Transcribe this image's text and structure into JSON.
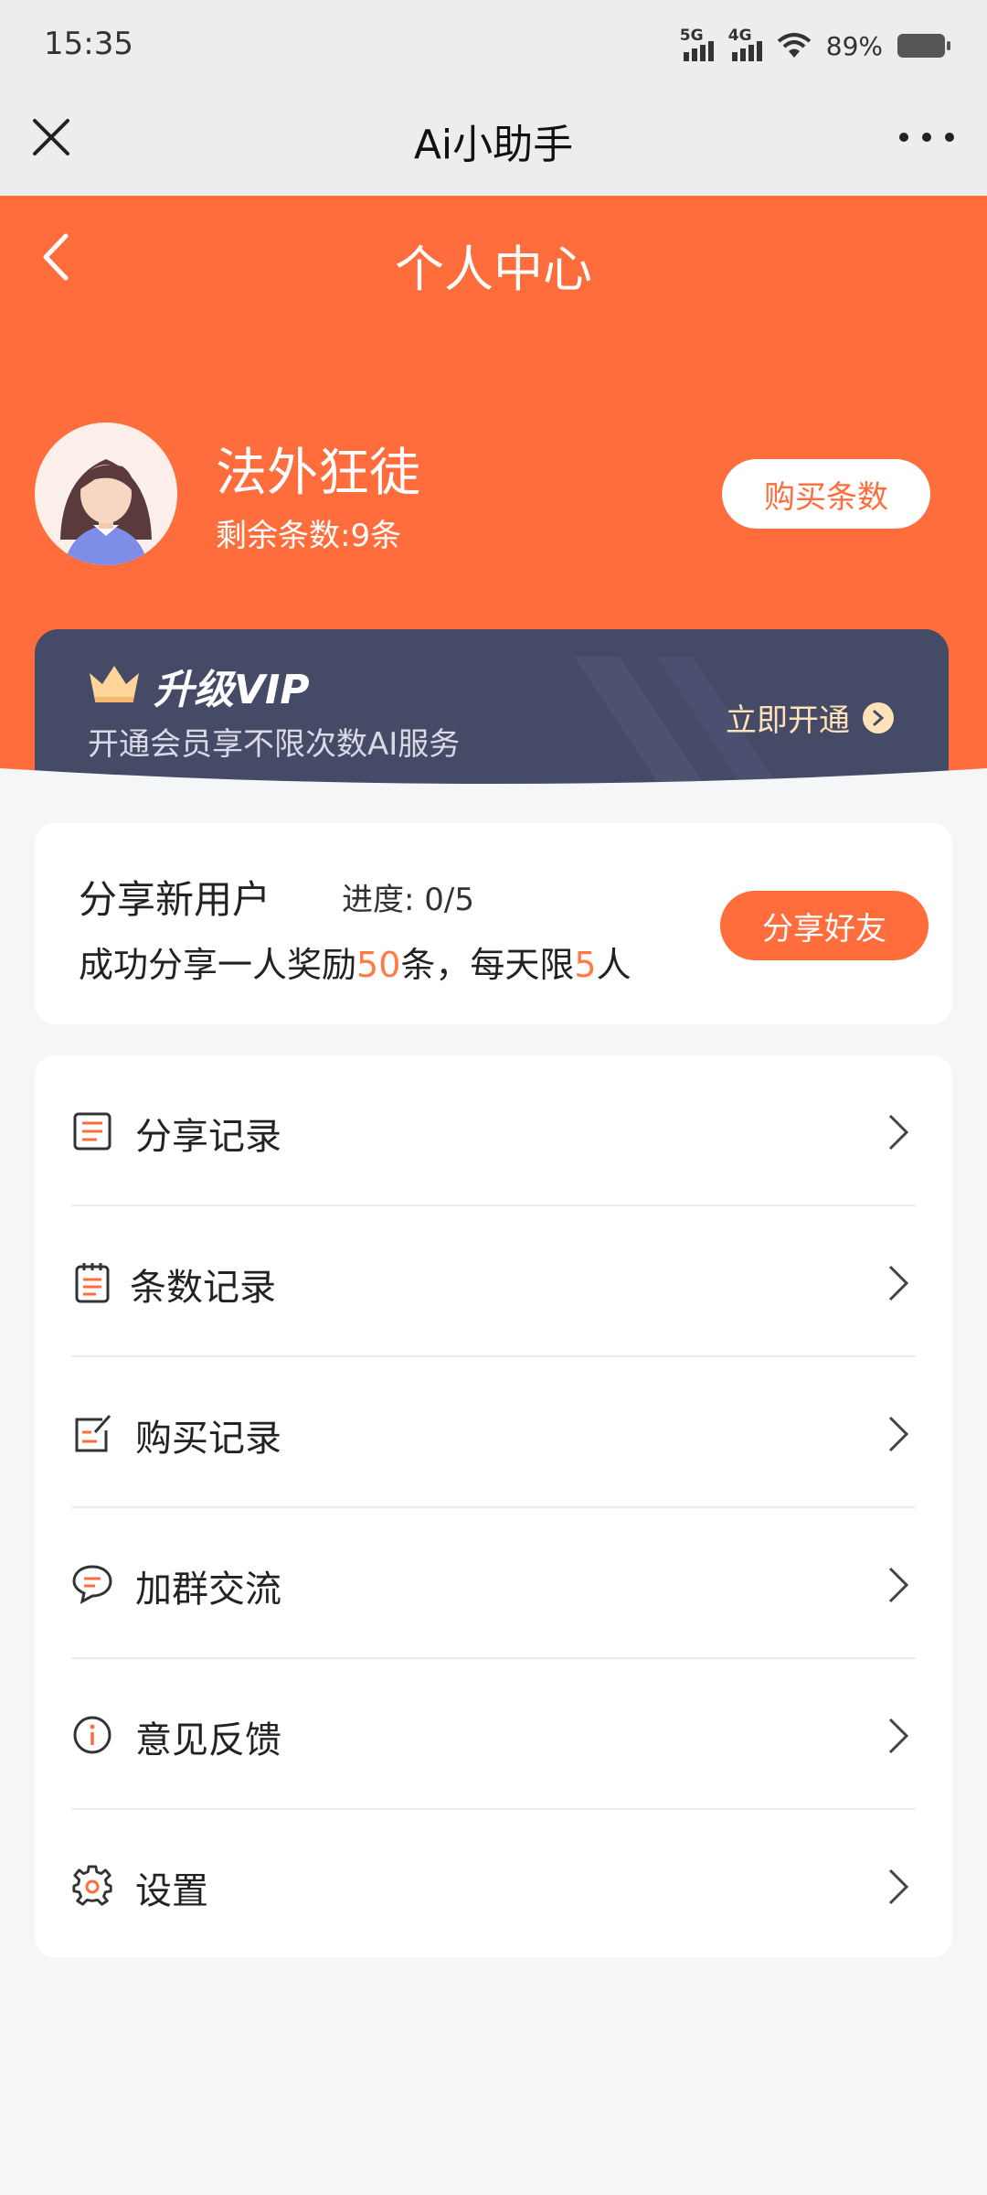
{
  "status_bar": {
    "time": "15:35",
    "signal_1": "5G",
    "signal_2": "4G",
    "battery": "89%"
  },
  "navbar": {
    "title": "Ai小助手"
  },
  "header": {
    "title": "个人中心",
    "username": "法外狂徒",
    "remaining": "剩余条数:9条",
    "buy_button": "购买条数"
  },
  "vip": {
    "title": "升级VIP",
    "subtitle": "开通会员享不限次数AI服务",
    "action": "立即开通"
  },
  "share": {
    "title": "分享新用户",
    "progress": "进度: 0/5",
    "desc_prefix": "成功分享一人奖励",
    "reward": "50",
    "desc_mid": "条，每天限",
    "limit": "5",
    "desc_suffix": "人",
    "button": "分享好友"
  },
  "menu": {
    "items": [
      {
        "label": "分享记录",
        "icon": "document-list-icon"
      },
      {
        "label": "条数记录",
        "icon": "notepad-icon"
      },
      {
        "label": "购买记录",
        "icon": "edit-note-icon"
      },
      {
        "label": "加群交流",
        "icon": "chat-bubble-icon"
      },
      {
        "label": "意见反馈",
        "icon": "info-icon"
      },
      {
        "label": "设置",
        "icon": "gear-icon"
      }
    ]
  },
  "colors": {
    "accent": "#ff6d3c",
    "vip_bg": "#454a66",
    "vip_gold": "#ffe2b8"
  }
}
